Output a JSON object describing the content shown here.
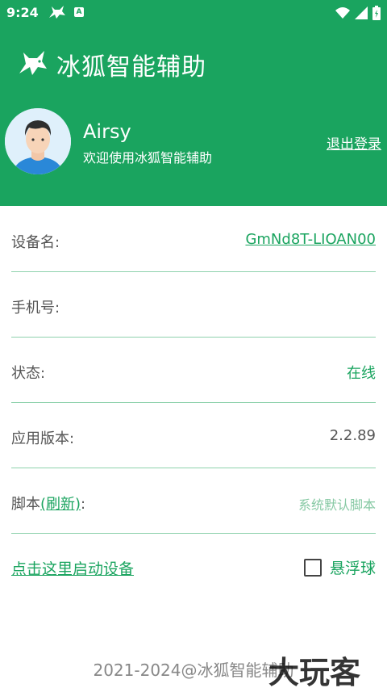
{
  "status_bar": {
    "time": "9:24",
    "icons": [
      "fox-icon",
      "a-icon",
      "wifi-icon",
      "signal-icon",
      "battery-icon"
    ],
    "a_glyph": "A"
  },
  "app": {
    "title": "冰狐智能辅助",
    "logo_icon": "fox-icon"
  },
  "user": {
    "name": "Airsy",
    "welcome": "欢迎使用冰狐智能辅助",
    "logout_label": "退出登录"
  },
  "info": {
    "device_label": "设备名:",
    "device_value": "GmNd8T-LIOAN00",
    "phone_label": "手机号:",
    "phone_value": "",
    "status_label": "状态:",
    "status_value": "在线",
    "version_label": "应用版本:",
    "version_value": "2.2.89",
    "script_label_prefix": "脚本",
    "script_refresh": "(刷新)",
    "script_colon": ":",
    "script_value": "系统默认脚本"
  },
  "actions": {
    "start_label": "点击这里启动设备",
    "float_label": "悬浮球",
    "float_checked": false
  },
  "footer": {
    "copyright": "2021-2024@冰狐智能辅助",
    "watermark": "大玩客"
  },
  "colors": {
    "primary": "#1aa45f",
    "divider": "#8fd2ad",
    "muted_green": "#87c9a4"
  }
}
